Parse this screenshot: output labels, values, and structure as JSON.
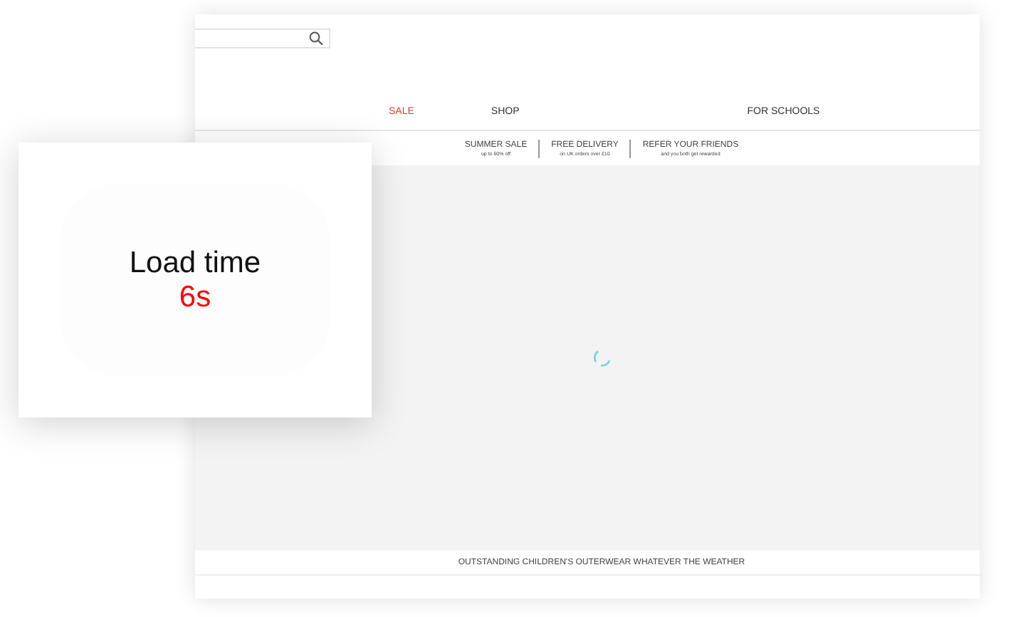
{
  "nav": [
    {
      "label": "SALE",
      "kind": "sale"
    },
    {
      "label": "SHOP",
      "kind": "normal"
    },
    {
      "label": "FOR SCHOOLS",
      "kind": "normal"
    }
  ],
  "promos": [
    {
      "title": "SUMMER SALE",
      "subtitle": "up to 60% off"
    },
    {
      "title": "FREE DELIVERY",
      "subtitle": "on UK orders over £10"
    },
    {
      "title": "REFER YOUR FRIENDS",
      "subtitle": "and you both get rewarded"
    }
  ],
  "banner": "OUTSTANDING CHILDREN'S OUTERWEAR WHATEVER THE WEATHER",
  "load_card": {
    "label": "Load time",
    "value": "6s"
  }
}
